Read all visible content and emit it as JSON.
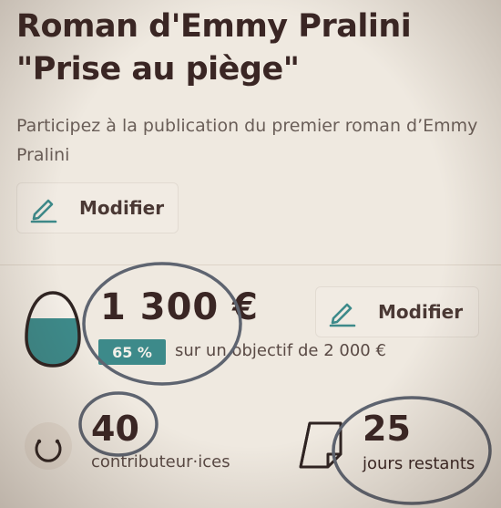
{
  "project": {
    "title_line1": "Roman d'Emmy Pralini",
    "title_line2": "\"Prise au piège\"",
    "description": "Participez à la publication du premier roman d’Emmy Pralini",
    "modify_label": "Modifier"
  },
  "funding": {
    "amount": "1 300 €",
    "percent_label": "65 %",
    "progress_fraction": 0.65,
    "objective_text": "sur un objectif de 2 000 €",
    "modify_label": "Modifier"
  },
  "stats": {
    "contributors_count": "40",
    "contributors_label": "contributeur·ices",
    "days_count": "25",
    "days_label": "jours restants"
  },
  "colors": {
    "accent": "#3d8a8a",
    "text_dark": "#3a2624",
    "annotation": "#5e6470"
  },
  "icons": {
    "edit": "pencil-icon",
    "funding": "egg-progress-icon",
    "contributors": "contributors-circle-icon",
    "days": "calendar-icon"
  }
}
